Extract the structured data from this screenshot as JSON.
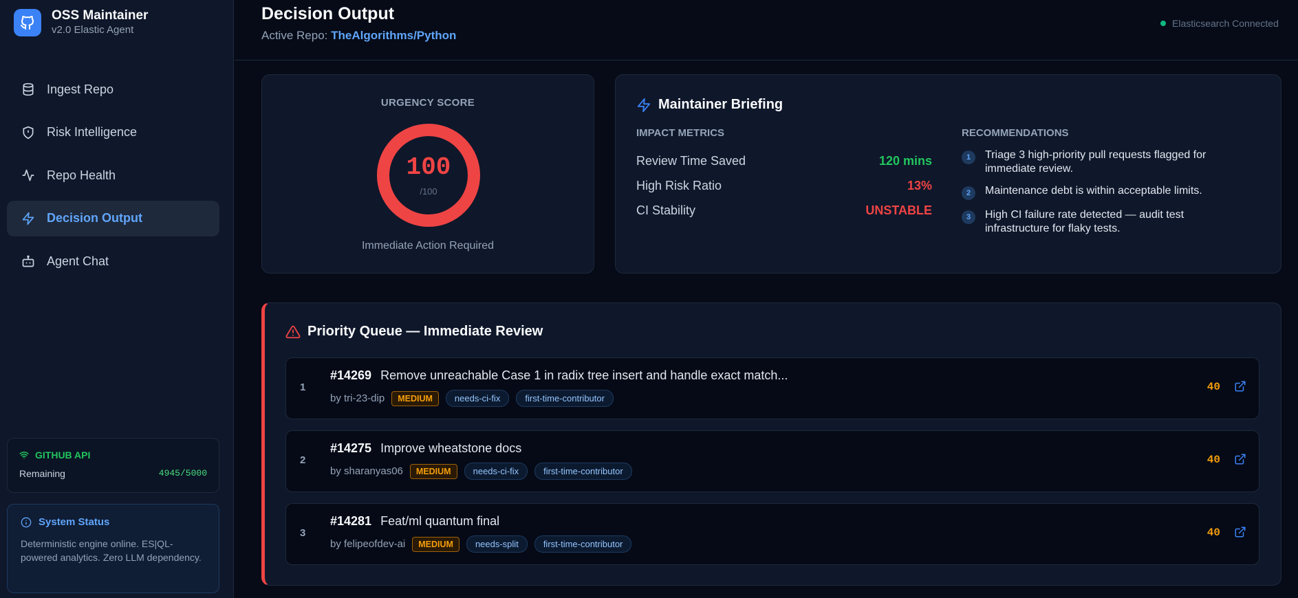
{
  "brand": {
    "title": "OSS Maintainer",
    "subtitle": "v2.0 Elastic Agent"
  },
  "nav": [
    {
      "label": "Ingest Repo",
      "icon": "database-icon"
    },
    {
      "label": "Risk Intelligence",
      "icon": "shield-alert-icon"
    },
    {
      "label": "Repo Health",
      "icon": "activity-icon"
    },
    {
      "label": "Decision Output",
      "icon": "lightning-icon",
      "active": true
    },
    {
      "label": "Agent Chat",
      "icon": "bot-icon"
    }
  ],
  "github_api": {
    "title": "GITHUB API",
    "remaining_label": "Remaining",
    "remaining_value": "4945/5000"
  },
  "system_status": {
    "title": "System Status",
    "text": "Deterministic engine online. ES|QL-powered analytics. Zero LLM dependency."
  },
  "header": {
    "title": "Decision Output",
    "repo_prefix": "Active Repo:",
    "repo_name": "TheAlgorithms/Python",
    "connection": "Elasticsearch Connected"
  },
  "urgency": {
    "label": "URGENCY SCORE",
    "score": "100",
    "max": "/100",
    "fraction": 1.0,
    "caption": "Immediate Action Required"
  },
  "briefing": {
    "title": "Maintainer Briefing",
    "metrics_label": "IMPACT METRICS",
    "metrics": [
      {
        "label": "Review Time Saved",
        "value": "120 mins",
        "tone": "green"
      },
      {
        "label": "High Risk Ratio",
        "value": "13%",
        "tone": "red"
      },
      {
        "label": "CI Stability",
        "value": "UNSTABLE",
        "tone": "red"
      }
    ],
    "recs_label": "RECOMMENDATIONS",
    "recommendations": [
      {
        "num": "1",
        "text": "Triage 3 high-priority pull requests flagged for immediate review."
      },
      {
        "num": "2",
        "text": "Maintenance debt is within acceptable limits."
      },
      {
        "num": "3",
        "text": "High CI failure rate detected — audit test infrastructure for flaky tests."
      }
    ]
  },
  "queue": {
    "title": "Priority Queue — Immediate Review",
    "items": [
      {
        "rank": "1",
        "number": "#14269",
        "title": "Remove unreachable Case 1 in radix tree insert and handle exact match...",
        "author": "by tri-23-dip",
        "severity": "MEDIUM",
        "tags": [
          "needs-ci-fix",
          "first-time-contributor"
        ],
        "score": "40"
      },
      {
        "rank": "2",
        "number": "#14275",
        "title": "Improve wheatstone docs",
        "author": "by sharanyas06",
        "severity": "MEDIUM",
        "tags": [
          "needs-ci-fix",
          "first-time-contributor"
        ],
        "score": "40"
      },
      {
        "rank": "3",
        "number": "#14281",
        "title": "Feat/ml quantum final",
        "author": "by felipeofdev-ai",
        "severity": "MEDIUM",
        "tags": [
          "needs-split",
          "first-time-contributor"
        ],
        "score": "40"
      }
    ]
  },
  "colors": {
    "accent": "#3b82f6",
    "danger": "#ef4444",
    "success": "#22c55e",
    "warning": "#f59e0b"
  }
}
